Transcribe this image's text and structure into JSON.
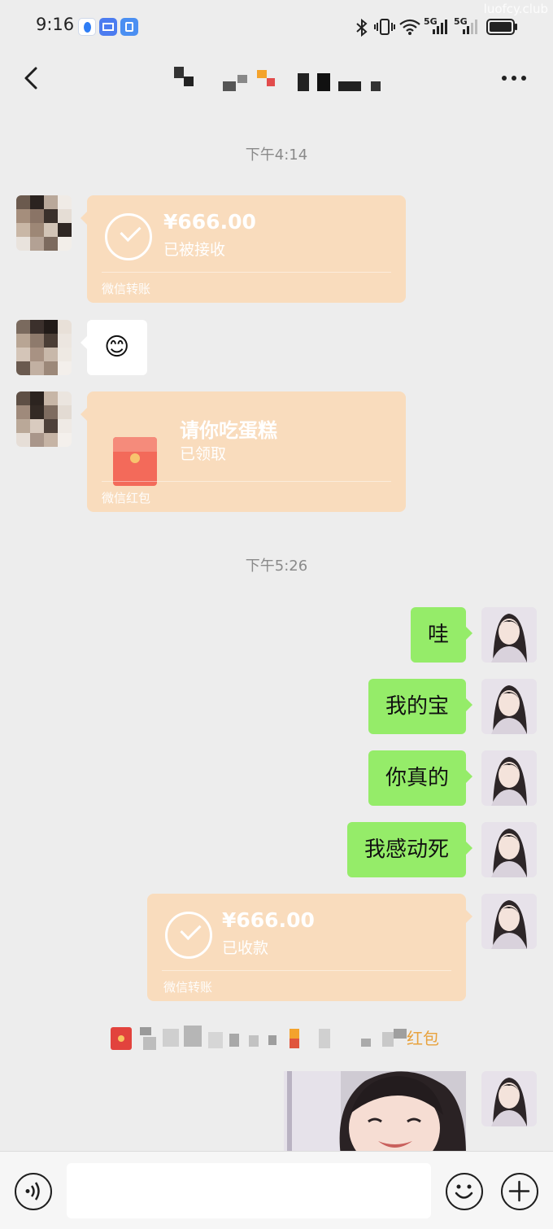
{
  "statusbar": {
    "time": "9:16",
    "watermark": "luofcy.club",
    "net1": "5G",
    "net2": "5G"
  },
  "header": {
    "back_icon": "chevron-left-icon",
    "more_icon": "more-dots-icon"
  },
  "timestamps": [
    "下午4:14",
    "下午5:26"
  ],
  "transfer_received": {
    "amount": "¥666.00",
    "status": "已被接收",
    "footer": "微信转账"
  },
  "emoji_message": "😊",
  "red_packet": {
    "title": "请你吃蛋糕",
    "status": "已领取",
    "footer": "微信红包"
  },
  "sent_messages": [
    "哇",
    "我的宝",
    "你真的",
    "我感动死"
  ],
  "transfer_collected": {
    "amount": "¥666.00",
    "status": "已收款",
    "footer": "微信转账"
  },
  "system_notice": {
    "visible_tail": "红包"
  },
  "colors": {
    "background": "#ededed",
    "sent_bubble": "#95ec69",
    "card": "#f9dcbd",
    "system_accent": "#e8a23d"
  },
  "inputbar": {
    "voice_icon": "voice-icon",
    "emoji_icon": "emoji-icon",
    "plus_icon": "plus-icon"
  }
}
